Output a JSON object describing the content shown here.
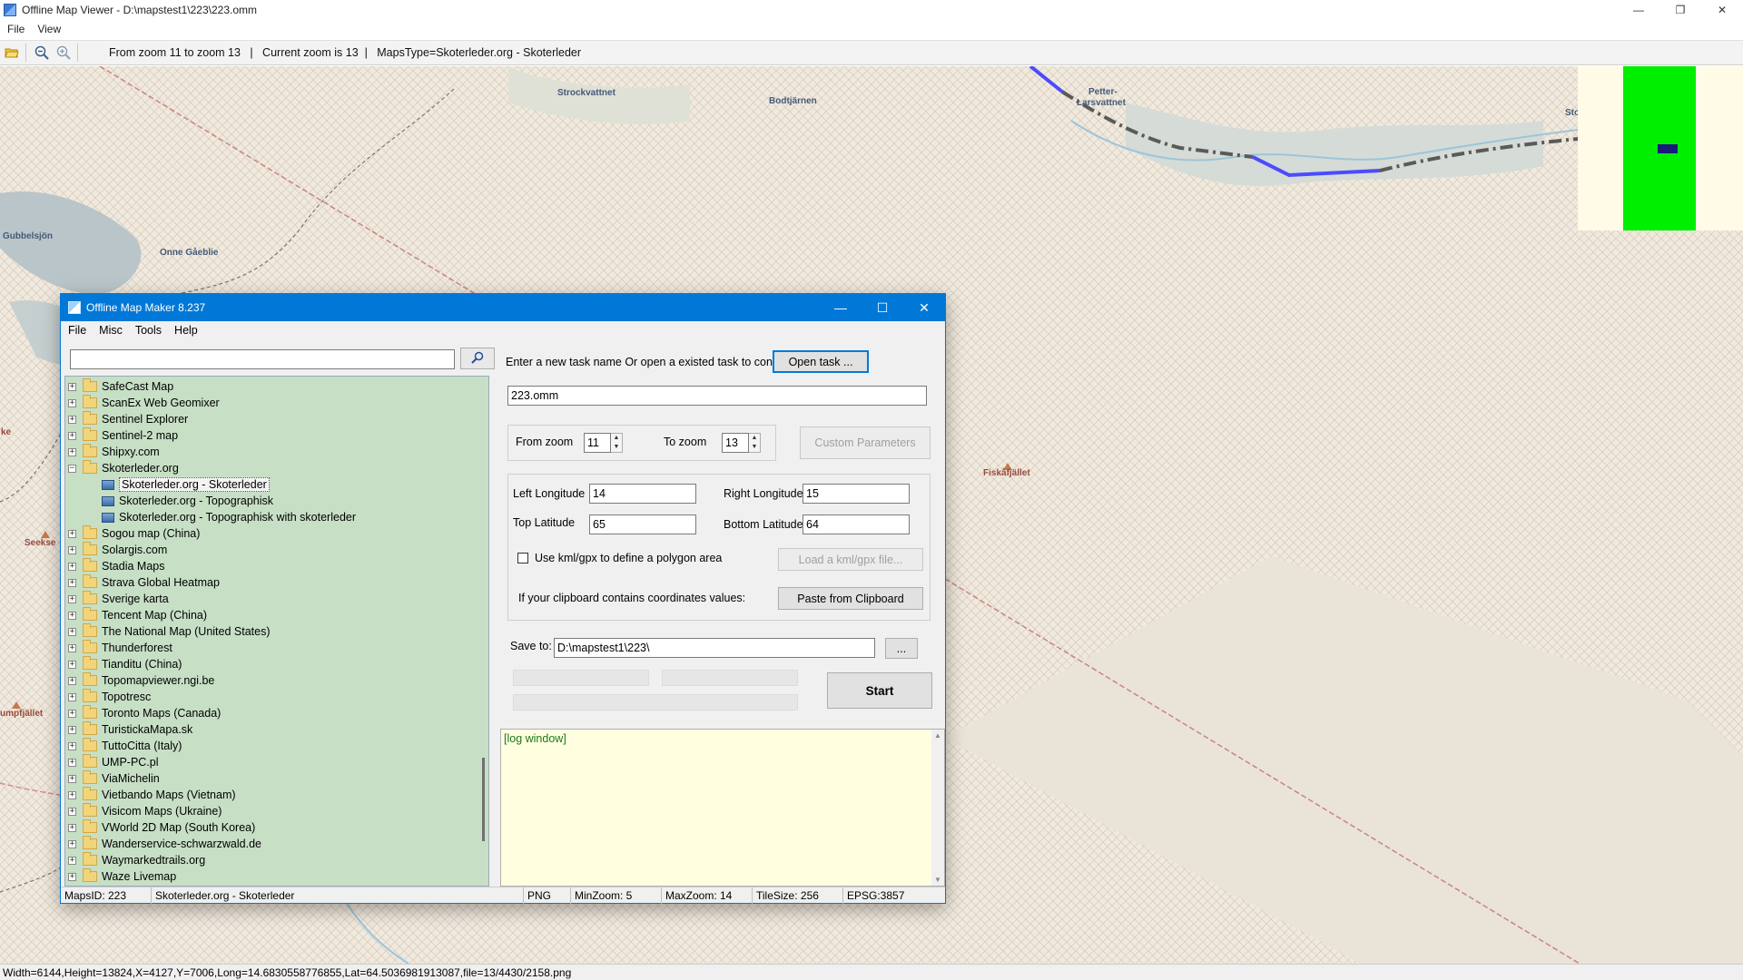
{
  "window": {
    "title": "Offline Map Viewer - D:\\mapstest1\\223\\223.omm",
    "menu": [
      "File",
      "View"
    ],
    "controls": {
      "minimize": "—",
      "maximize": "❐",
      "close": "✕"
    }
  },
  "toolbar": {
    "info": "From zoom 11 to zoom 13   |   Current zoom is 13  |   MapsType=Skoterleder.org - Skoterleder",
    "icons": [
      "open-folder-icon",
      "zoom-out-icon",
      "zoom-in-icon"
    ]
  },
  "map": {
    "labels": {
      "strockvattnet": "Strockvattnet",
      "bodtjarnen": "Bodtjärnen",
      "petter1": "Petter-",
      "petter2": "Larsvattnet",
      "sto": "Sto",
      "gubbelsjon": "Gubbelsjön",
      "onne": "Onne Gåeblie",
      "fiskafjallet": "Fiskåfjället",
      "seekse": "Seekse",
      "ke": "ke",
      "umpfjallet": "umpfjället"
    }
  },
  "statusbar": {
    "text": "Width=6144,Height=13824,X=4127,Y=7006,Long=14.6830558776855,Lat=64.5036981913087,file=13/4430/2158.png"
  },
  "dialog": {
    "title": "Offline Map Maker 8.237",
    "menu": [
      "File",
      "Misc",
      "Tools",
      "Help"
    ],
    "search": {
      "value": "",
      "placeholder": ""
    },
    "tree": [
      {
        "label": "SafeCast Map",
        "type": "folder"
      },
      {
        "label": "ScanEx Web Geomixer",
        "type": "folder"
      },
      {
        "label": "Sentinel Explorer",
        "type": "folder"
      },
      {
        "label": "Sentinel-2 map",
        "type": "folder"
      },
      {
        "label": "Shipxy.com",
        "type": "folder"
      },
      {
        "label": "Skoterleder.org",
        "type": "folder-open"
      },
      {
        "label": "Skoterleder.org - Skoterleder",
        "type": "leaf",
        "selected": true
      },
      {
        "label": "Skoterleder.org - Topographisk",
        "type": "leaf"
      },
      {
        "label": "Skoterleder.org - Topographisk with skoterleder",
        "type": "leaf"
      },
      {
        "label": "Sogou map (China)",
        "type": "folder"
      },
      {
        "label": "Solargis.com",
        "type": "folder"
      },
      {
        "label": "Stadia Maps",
        "type": "folder"
      },
      {
        "label": "Strava Global Heatmap",
        "type": "folder"
      },
      {
        "label": "Sverige karta",
        "type": "folder"
      },
      {
        "label": "Tencent Map (China)",
        "type": "folder"
      },
      {
        "label": "The National Map (United States)",
        "type": "folder"
      },
      {
        "label": "Thunderforest",
        "type": "folder"
      },
      {
        "label": "Tianditu (China)",
        "type": "folder"
      },
      {
        "label": "Topomapviewer.ngi.be",
        "type": "folder"
      },
      {
        "label": "Topotresc",
        "type": "folder"
      },
      {
        "label": "Toronto Maps (Canada)",
        "type": "folder"
      },
      {
        "label": "TuristickaMapa.sk",
        "type": "folder"
      },
      {
        "label": "TuttoCitta (Italy)",
        "type": "folder"
      },
      {
        "label": "UMP-PC.pl",
        "type": "folder"
      },
      {
        "label": "ViaMichelin",
        "type": "folder"
      },
      {
        "label": "Vietbando Maps (Vietnam)",
        "type": "folder"
      },
      {
        "label": "Visicom Maps (Ukraine)",
        "type": "folder"
      },
      {
        "label": "VWorld 2D Map (South Korea)",
        "type": "folder"
      },
      {
        "label": "Wanderservice-schwarzwald.de",
        "type": "folder"
      },
      {
        "label": "Waymarkedtrails.org",
        "type": "folder"
      },
      {
        "label": "Waze Livemap",
        "type": "folder"
      }
    ],
    "form": {
      "task_prompt": "Enter a new task name Or open a existed task to continue:",
      "open_task": "Open task ...",
      "task_name": "223.omm",
      "from_zoom_label": "From zoom",
      "from_zoom": "11",
      "to_zoom_label": "To zoom",
      "to_zoom": "13",
      "custom_params": "Custom Parameters",
      "left_lon_label": "Left Longitude",
      "left_lon": "14",
      "right_lon_label": "Right Longitude",
      "right_lon": "15",
      "top_lat_label": "Top Latitude",
      "top_lat": "65",
      "bottom_lat_label": "Bottom Latitude",
      "bottom_lat": "64",
      "kml_label": "Use kml/gpx to define a polygon area",
      "load_kml": "Load a kml/gpx file...",
      "clipboard_label": "If your clipboard contains coordinates values:",
      "paste_clipboard": "Paste from Clipboard",
      "save_to_label": "Save to:",
      "save_to": "D:\\mapstest1\\223\\",
      "browse": "...",
      "start": "Start",
      "log": "[log window]"
    },
    "status": {
      "maps_id": "MapsID: 223",
      "map_name": "Skoterleder.org - Skoterleder",
      "format": "PNG",
      "min_zoom": "MinZoom: 5",
      "max_zoom": "MaxZoom: 14",
      "tile_size": "TileSize: 256",
      "epsg": "EPSG:3857"
    }
  }
}
